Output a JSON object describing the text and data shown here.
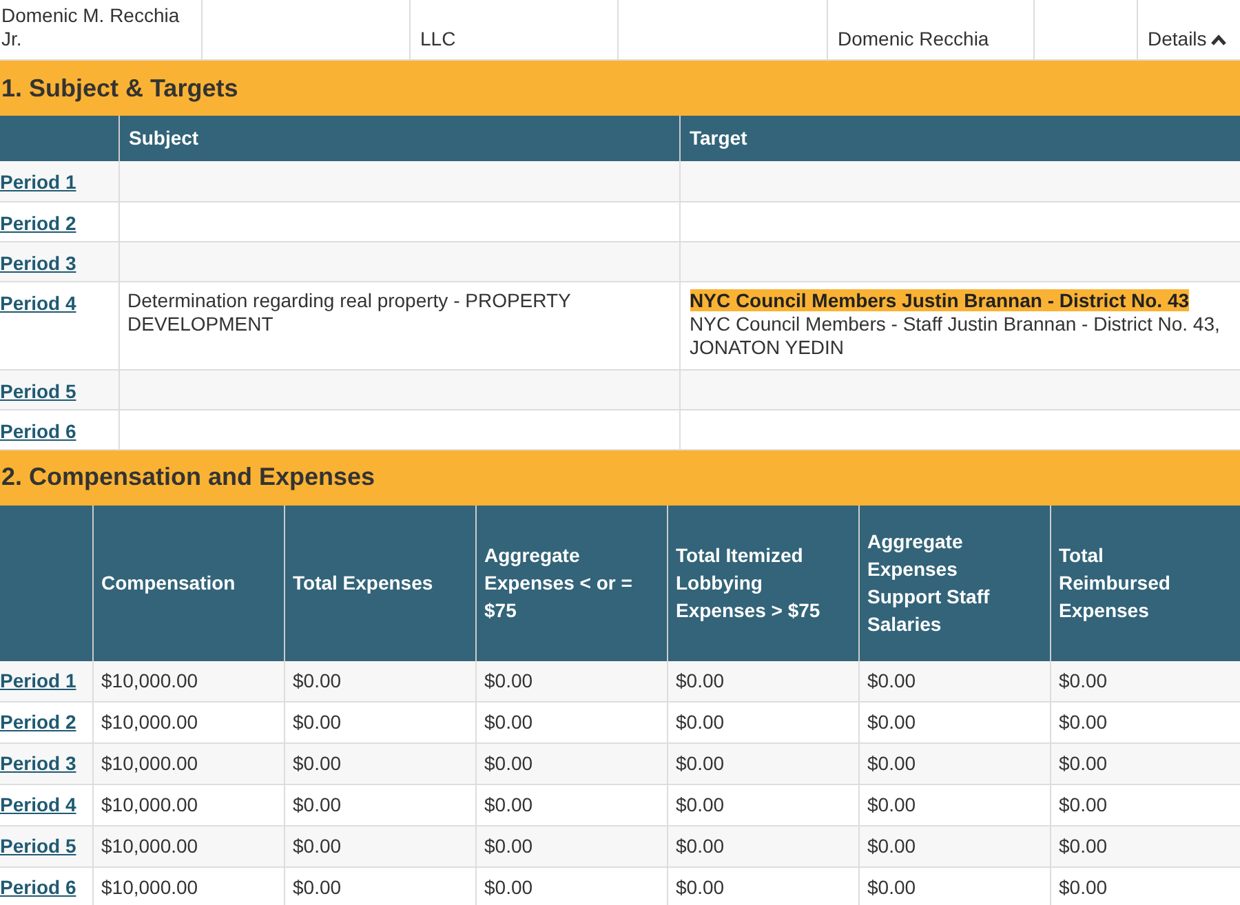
{
  "top_row": {
    "cells": [
      {
        "kind": "text",
        "lines": [
          "Domenic M. Recchia",
          "Jr."
        ]
      },
      {
        "kind": "empty"
      },
      {
        "kind": "text",
        "lines": [
          "LLC"
        ]
      },
      {
        "kind": "empty"
      },
      {
        "kind": "text",
        "lines": [
          "Domenic Recchia"
        ]
      },
      {
        "kind": "empty"
      },
      {
        "kind": "toggle",
        "lines": [
          "Details"
        ]
      }
    ]
  },
  "section_1": {
    "title": "1. Subject & Targets",
    "columns": [
      "Subject",
      "Target"
    ],
    "rows": [
      {
        "period": "Period 1"
      },
      {
        "period": "Period 2"
      },
      {
        "period": "Period 3"
      },
      {
        "period": "Period 4",
        "subject": "Determination regarding real property - PROPERTY DEVELOPMENT",
        "target_highlight": "NYC Council Members Justin Brannan - District No. 43",
        "target": "NYC Council Members - Staff Justin Brannan - District No. 43, JONATON YEDIN"
      },
      {
        "period": "Period 5"
      },
      {
        "period": "Period 6"
      }
    ]
  },
  "section_2": {
    "title": "2. Compensation and Expenses",
    "columns": [
      "Compensation",
      "Total Expenses",
      "Aggregate Expenses < or = $75",
      "Total Itemized Lobbying Expenses > $75",
      "Aggregate Expenses Support Staff Salaries",
      "Total Reimbursed Expenses"
    ],
    "rows": [
      {
        "period": "Period 1",
        "values": [
          "$10,000.00",
          "$0.00",
          "$0.00",
          "$0.00",
          "$0.00",
          "$0.00"
        ]
      },
      {
        "period": "Period 2",
        "values": [
          "$10,000.00",
          "$0.00",
          "$0.00",
          "$0.00",
          "$0.00",
          "$0.00"
        ]
      },
      {
        "period": "Period 3",
        "values": [
          "$10,000.00",
          "$0.00",
          "$0.00",
          "$0.00",
          "$0.00",
          "$0.00"
        ]
      },
      {
        "period": "Period 4",
        "values": [
          "$10,000.00",
          "$0.00",
          "$0.00",
          "$0.00",
          "$0.00",
          "$0.00"
        ]
      },
      {
        "period": "Period 5",
        "values": [
          "$10,000.00",
          "$0.00",
          "$0.00",
          "$0.00",
          "$0.00",
          "$0.00"
        ]
      },
      {
        "period": "Period 6",
        "values": [
          "$10,000.00",
          "$0.00",
          "$0.00",
          "$0.00",
          "$0.00",
          "$0.00"
        ]
      }
    ]
  }
}
